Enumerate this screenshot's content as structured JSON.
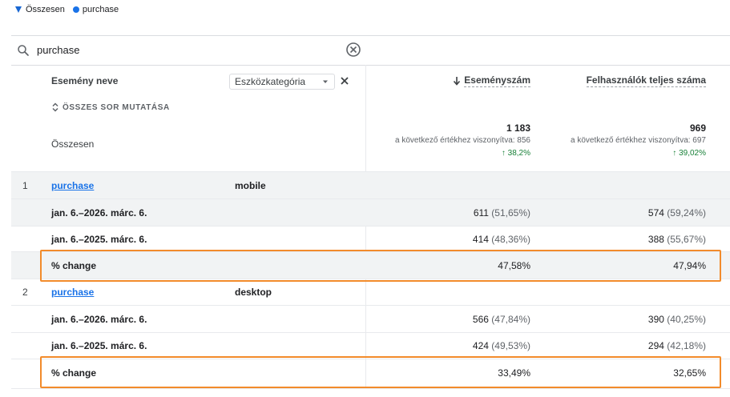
{
  "legend": {
    "total_label": "Összesen",
    "series_label": "purchase",
    "total_color": "#1967d2",
    "series_color": "#1a73e8"
  },
  "search": {
    "value": "purchase"
  },
  "table": {
    "dimension_header": "Esemény neve",
    "secondary_dimension": "Eszközkategória",
    "show_all_rows": "ÖSSZES SOR MUTATÁSA",
    "metric1_header": "Eseményszám",
    "metric2_header": "Felhasználók teljes száma",
    "totals": {
      "label": "Összesen",
      "metric1": {
        "value": "1 183",
        "compare": "a következő értékhez viszonyítva: 856",
        "change": "38,2%"
      },
      "metric2": {
        "value": "969",
        "compare": "a következő értékhez viszonyítva: 697",
        "change": "39,02%"
      }
    },
    "rows": [
      {
        "rank": "1",
        "event": "purchase",
        "device": "mobile",
        "periods": [
          {
            "label": "jan. 6.–2026. márc. 6.",
            "m1": "611",
            "m1_pct": "(51,65%)",
            "m2": "574",
            "m2_pct": "(59,24%)"
          },
          {
            "label": "jan. 6.–2025. márc. 6.",
            "m1": "414",
            "m1_pct": "(48,36%)",
            "m2": "388",
            "m2_pct": "(55,67%)"
          }
        ],
        "change": {
          "label": "% change",
          "m1": "47,58%",
          "m2": "47,94%"
        }
      },
      {
        "rank": "2",
        "event": "purchase",
        "device": "desktop",
        "periods": [
          {
            "label": "jan. 6.–2026. márc. 6.",
            "m1": "566",
            "m1_pct": "(47,84%)",
            "m2": "390",
            "m2_pct": "(40,25%)"
          },
          {
            "label": "jan. 6.–2025. márc. 6.",
            "m1": "424",
            "m1_pct": "(49,53%)",
            "m2": "294",
            "m2_pct": "(42,18%)"
          }
        ],
        "change": {
          "label": "% change",
          "m1": "33,49%",
          "m2": "32,65%"
        }
      }
    ]
  },
  "highlight_color": "#f28b2b"
}
